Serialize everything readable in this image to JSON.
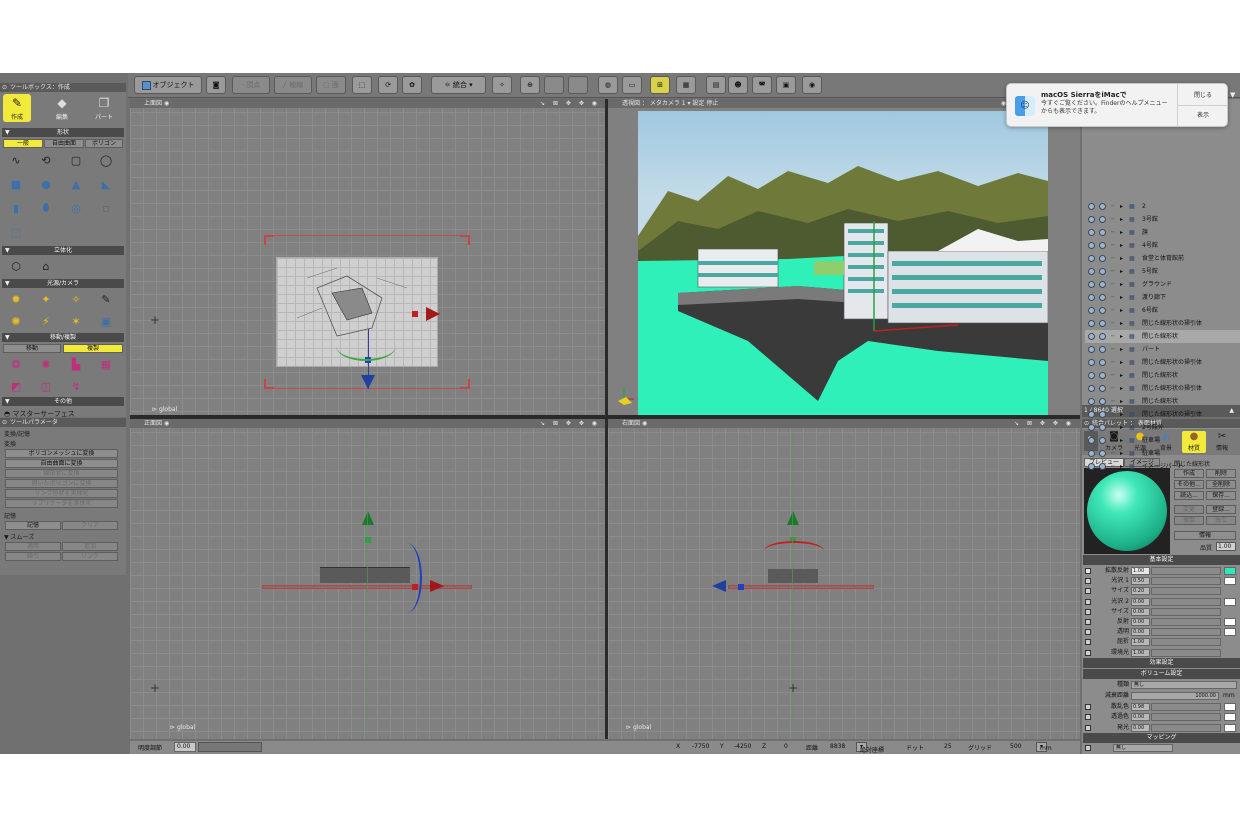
{
  "toolbox": {
    "title": "ツールボックス：作成",
    "modes": [
      "作成",
      "編集",
      "パート"
    ],
    "section_shape": "形状",
    "shape_tabs": [
      "一般",
      "自由曲面",
      "ポリゴン"
    ],
    "section_solid": "立体化",
    "section_light": "光源/カメラ",
    "section_move": "移動/複製",
    "move_tabs": [
      "移動",
      "複製"
    ],
    "section_other": "その他",
    "master_surface": "マスターサーフェス"
  },
  "toolparam": {
    "title": "ツールパラメータ",
    "header": "変換/記憶",
    "convert_label": "変換",
    "convert_buttons": [
      "ポリゴンメッシュに変換",
      "自由曲面に変換",
      "線形状に変換",
      "開いたポリゴンに変換",
      "リンク形状を実体化",
      "リプリケータを実体化"
    ],
    "memory_label": "記憶",
    "memory_buttons": [
      "記憶",
      "クリア"
    ],
    "smooth_label": "スムーズ",
    "smooth_buttons": [
      "適用",
      "追加",
      "繰引",
      "リンク"
    ]
  },
  "toolbar": {
    "object_button": "オブジェクト",
    "vertex_button": "頂点",
    "edge_button": "稜線",
    "face_button": "面",
    "merge_button": "統合"
  },
  "viewports": {
    "top": "上面図",
    "perspective": "透視図 ： メタカメラ 1",
    "perspective_settings": "設定",
    "perspective_stop": "停止",
    "front": "正面図",
    "right": "右面図",
    "global_label": "global"
  },
  "browser": {
    "items": [
      "2",
      "3号館",
      "旗",
      "4号館",
      "食堂と体育館前",
      "5号館",
      "グラウンド",
      "渡り廊下",
      "6号館",
      "閉じた線形状の掃引体",
      "閉じた線形状",
      "パート",
      "閉じた線形状の掃引体",
      "閉じた線形状",
      "閉じた線形状の掃引体",
      "閉じた線形状",
      "閉じた線形状の掃引体",
      "2号館外",
      "駐車場",
      "駐車場",
      "イメージパート"
    ],
    "selected_index": 10,
    "footer": "1 / 8640 選択"
  },
  "palette": {
    "title": "統合パレット ： 表面材質",
    "tabs": [
      "カメラ",
      "光源",
      "背景",
      "材質",
      "情報"
    ],
    "preview_tab": "プレビュー",
    "image_tab": "イメージ",
    "material_name": "閉じた線形状",
    "buttons": [
      "作成",
      "削除",
      "その他...",
      "全削除",
      "読込...",
      "保存...",
      "変更",
      "登録...",
      "複製",
      "独立"
    ],
    "info_button": "情報",
    "quality_label": "品質",
    "quality_value": "1.00",
    "basic_header": "基本設定",
    "rows": [
      {
        "label": "拡散反射",
        "value": "1.00",
        "checked": true,
        "swatch": "#2ee8b8"
      },
      {
        "label": "光沢 1",
        "value": "0.50",
        "checked": false,
        "swatch": "#ffffff"
      },
      {
        "label": "サイズ",
        "value": "0.20",
        "checked": false,
        "swatch": ""
      },
      {
        "label": "光沢 2",
        "value": "0.00",
        "checked": false,
        "swatch": "#ffffff"
      },
      {
        "label": "サイズ",
        "value": "0.00",
        "checked": false,
        "swatch": ""
      },
      {
        "label": "反射",
        "value": "0.00",
        "checked": false,
        "swatch": "#ffffff"
      },
      {
        "label": "透明",
        "value": "0.00",
        "checked": false,
        "swatch": "#ffffff"
      },
      {
        "label": "屈折",
        "value": "1.00",
        "checked": false,
        "swatch": ""
      },
      {
        "label": "環境光",
        "value": "1.00",
        "checked": false,
        "swatch": ""
      }
    ],
    "effect_header": "効果設定",
    "volume_header": "ボリューム設定",
    "volume_type_label": "種類",
    "volume_type_value": "無し",
    "attenuation_label": "減衰距離",
    "attenuation_value": "1000.00",
    "attenuation_unit": "mm",
    "volume_rows": [
      {
        "label": "散乱色",
        "value": "0.98"
      },
      {
        "label": "透過色",
        "value": "0.00"
      },
      {
        "label": "発光",
        "value": "0.00"
      }
    ],
    "mapping_header": "マッピング",
    "mapping_value": "無し"
  },
  "status": {
    "brightness_label": "明度調節",
    "brightness_value": "0.00",
    "x_label": "X",
    "x_value": "-7750",
    "y_label": "Y",
    "y_value": "-4250",
    "z_label": "Z",
    "z_value": "0",
    "distance_label": "距離",
    "distance_value": "8838",
    "coord_mode": "絶対座標",
    "dot_label": "ドット",
    "dot_value": "25",
    "grid_label": "グリッド",
    "grid_value": "500",
    "unit": "mm"
  },
  "notification": {
    "title": "macOS SierraをiMacで",
    "body": "今すぐご覧ください。Finderのヘルプメニューからも表示できます。",
    "close_button": "閉じる",
    "show_button": "表示"
  }
}
